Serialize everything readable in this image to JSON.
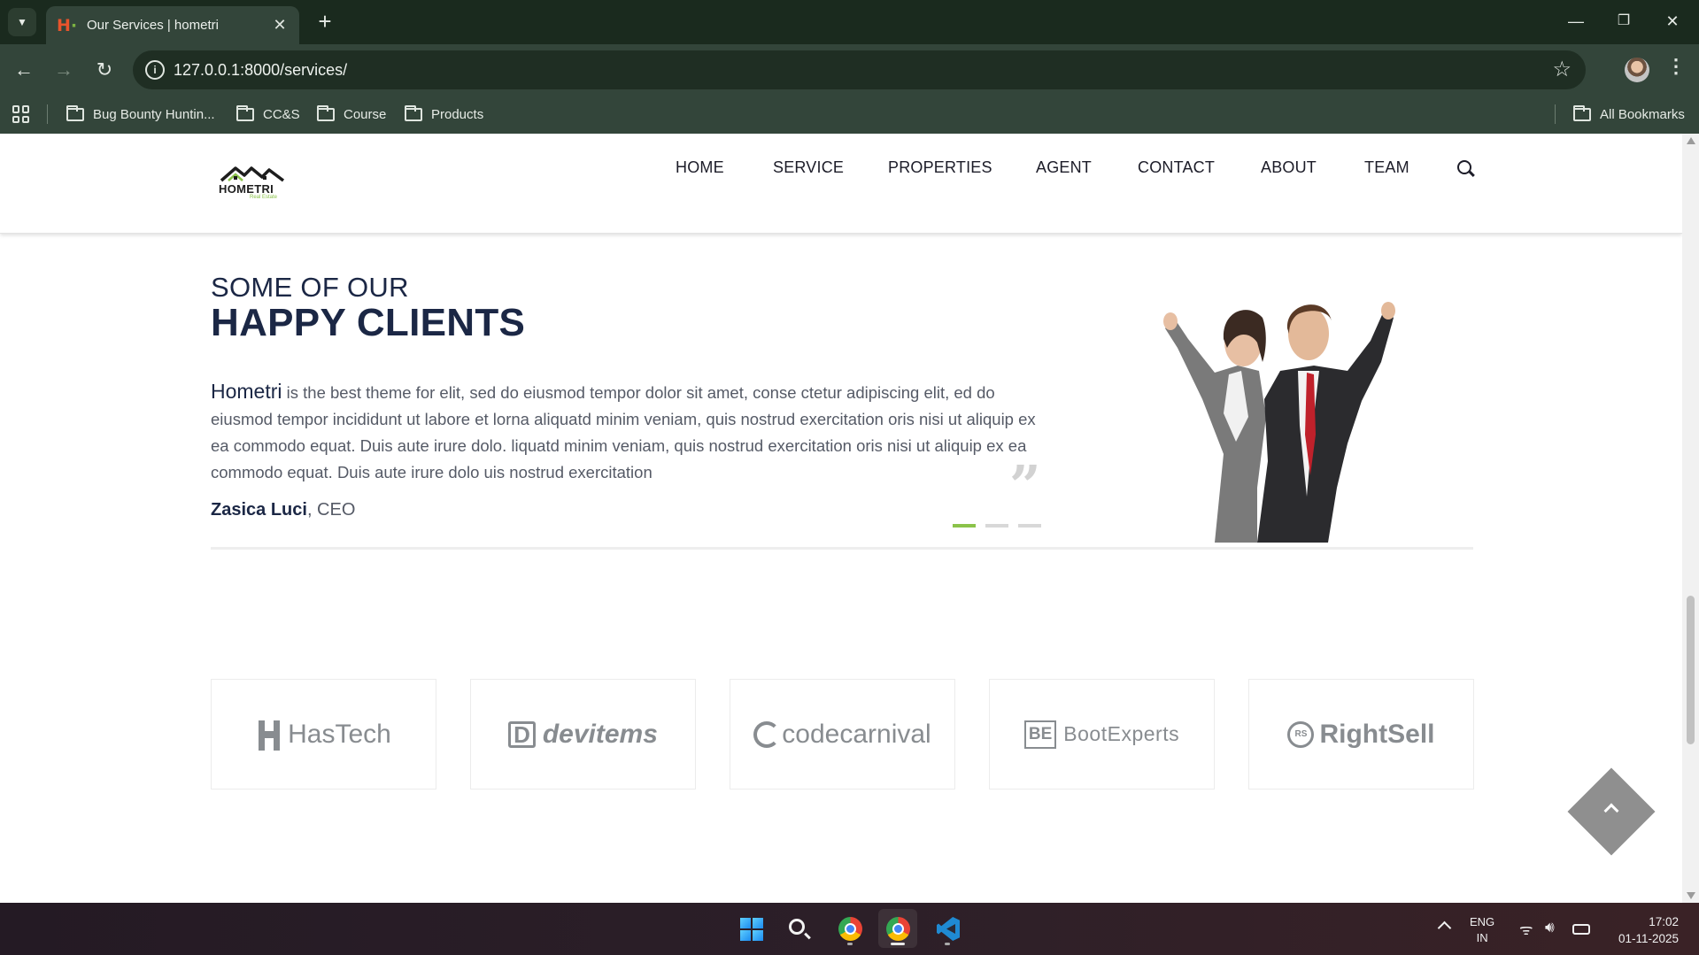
{
  "browser": {
    "tab": {
      "title": "Our Services | hometri",
      "favicon": "hometri-favicon"
    },
    "address_bar": {
      "url": "127.0.0.1:8000/services/"
    },
    "bookmarks": [
      {
        "label": "Bug Bounty Huntin...",
        "icon": "folder-icon"
      },
      {
        "label": "CC&S",
        "icon": "folder-icon"
      },
      {
        "label": "Course",
        "icon": "folder-icon"
      },
      {
        "label": "Products",
        "icon": "folder-icon"
      }
    ],
    "all_bookmarks_label": "All Bookmarks"
  },
  "site": {
    "logo": {
      "name": "HOMETRI",
      "tagline": "Real Estate",
      "colors": {
        "roof": "#1d1d1d",
        "accent": "#8bc34a"
      }
    },
    "nav": [
      {
        "label": "HOME"
      },
      {
        "label": "SERVICE"
      },
      {
        "label": "PROPERTIES"
      },
      {
        "label": "AGENT"
      },
      {
        "label": "CONTACT"
      },
      {
        "label": "ABOUT"
      },
      {
        "label": "TEAM"
      }
    ]
  },
  "testimonials": {
    "pre_title": "SOME OF OUR",
    "title": "HAPPY CLIENTS",
    "brand": "Hometri",
    "text": " is the best theme for elit, sed do eiusmod tempor dolor sit amet, conse ctetur adipiscing elit, ed do eiusmod tempor incididunt ut labore et lorna aliquatd minim veniam, quis nostrud exercitation oris nisi ut aliquip ex ea commodo equat. Duis aute irure dolo. liquatd minim veniam, quis nostrud exercitation oris nisi ut aliquip ex ea commodo equat. Duis aute irure dolo uis nostrud exercitation",
    "author_name": "Zasica Luci",
    "author_role": ", CEO",
    "slides": 3,
    "active_slide": 1,
    "accent_color": "#8bc34a"
  },
  "partners": [
    {
      "name": "HasTech",
      "icon": "hastech-logo-icon"
    },
    {
      "name": "devitems",
      "icon": "devitems-logo-icon"
    },
    {
      "name": "codecarnival",
      "icon": "codecarnival-logo-icon"
    },
    {
      "name": "BootExperts",
      "icon": "bootexperts-logo-icon"
    },
    {
      "name": "RightSell",
      "icon": "rightsell-logo-icon"
    }
  ],
  "taskbar": {
    "language": {
      "line1": "ENG",
      "line2": "IN"
    },
    "time": "17:02",
    "date": "01-11-2025"
  }
}
